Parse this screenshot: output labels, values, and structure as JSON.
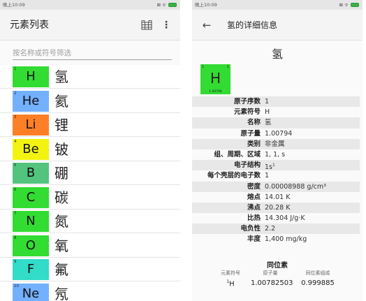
{
  "left_screen": {
    "status_bar": {
      "time": "晚上10:09",
      "icons": "⊠ ᯤ"
    },
    "app_bar": {
      "title": "元素列表",
      "grid_icon": "periodic-table-icon",
      "menu_icon": "overflow-menu-icon"
    },
    "filter": {
      "placeholder": "按名称或符号筛选",
      "value": ""
    },
    "elements": [
      {
        "number": "1",
        "symbol": "H",
        "name": "氢",
        "color": "#32dc32"
      },
      {
        "number": "2",
        "symbol": "He",
        "name": "氦",
        "color": "#73b0ff"
      },
      {
        "number": "3",
        "symbol": "Li",
        "name": "锂",
        "color": "#ff7f27"
      },
      {
        "number": "4",
        "symbol": "Be",
        "name": "铍",
        "color": "#f3f312"
      },
      {
        "number": "5",
        "symbol": "B",
        "name": "硼",
        "color": "#52c47e"
      },
      {
        "number": "6",
        "symbol": "C",
        "name": "碳",
        "color": "#32dc32"
      },
      {
        "number": "7",
        "symbol": "N",
        "name": "氮",
        "color": "#32dc32"
      },
      {
        "number": "8",
        "symbol": "O",
        "name": "氧",
        "color": "#32dc32"
      },
      {
        "number": "9",
        "symbol": "F",
        "name": "氟",
        "color": "#32dcc8"
      },
      {
        "number": "10",
        "symbol": "Ne",
        "name": "氖",
        "color": "#73b0ff"
      }
    ]
  },
  "right_screen": {
    "status_bar": {
      "time": "晚上10:09",
      "icons": "⊠ ᯤ"
    },
    "app_bar": {
      "back_icon": "back-arrow-icon",
      "title": "氢的详细信息"
    },
    "element_name": "氢",
    "tile": {
      "number": "1",
      "valence": "1",
      "symbol": "H",
      "mass": "1.00794",
      "color": "#32dc32"
    },
    "properties": [
      {
        "label": "原子序数",
        "value": "1"
      },
      {
        "label": "元素符号",
        "value": "H"
      },
      {
        "label": "名称",
        "value": "氢"
      },
      {
        "label": "原子量",
        "value": "1.00794"
      },
      {
        "label": "类别",
        "value": "非金属"
      },
      {
        "label": "组、周期、区域",
        "value": "1, 1, s"
      },
      {
        "label": "电子结构",
        "value": "1s",
        "sup": "1"
      },
      {
        "label": "每个壳层的电子数",
        "value": "1"
      },
      {
        "label": "密度",
        "value": "0.00008988 g/cm³"
      },
      {
        "label": "熔点",
        "value": "14.01 K"
      },
      {
        "label": "沸点",
        "value": "20.28 K"
      },
      {
        "label": "比热",
        "value": "14.304 J/g·K"
      },
      {
        "label": "电负性",
        "value": "2.2"
      },
      {
        "label": "丰度",
        "value": "1,400 mg/kg"
      }
    ],
    "isotopes": {
      "title": "同位素",
      "headers": [
        "元素符号",
        "原子量",
        "同位素组成"
      ],
      "rows": [
        {
          "mass_number": "1",
          "symbol": "H",
          "mass": "1.00782503",
          "composition": "0.999885"
        }
      ]
    }
  }
}
